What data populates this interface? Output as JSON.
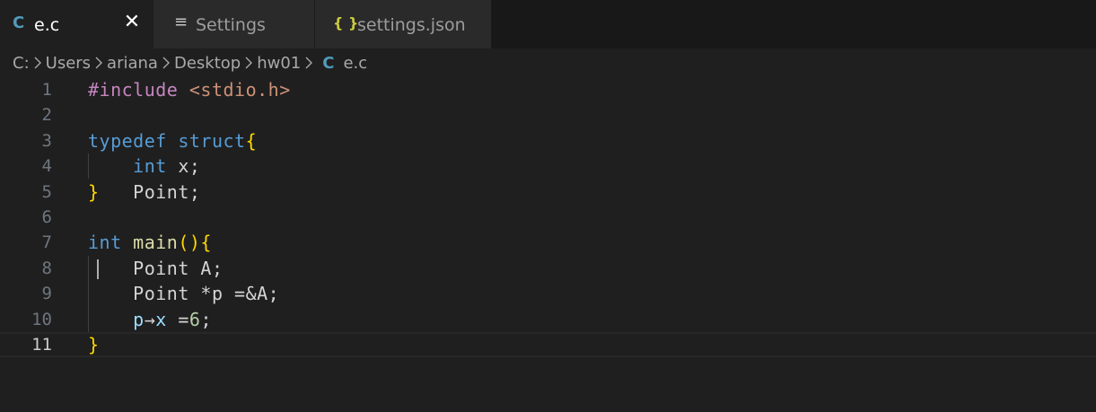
{
  "tabs": [
    {
      "icon": "C",
      "label": "e.c",
      "close": "✕"
    },
    {
      "icon": "≡",
      "label": "Settings"
    },
    {
      "icon": "{ }",
      "label": "settings.json"
    }
  ],
  "breadcrumb": {
    "parts": [
      "C:",
      "Users",
      "ariana",
      "Desktop",
      "hw01"
    ],
    "file_icon": "C",
    "file": "e.c"
  },
  "editor": {
    "current_line": 11,
    "lines": [
      {
        "n": "1",
        "tokens": [
          [
            "#include ",
            "pre"
          ],
          [
            "<stdio.h>",
            "str"
          ]
        ]
      },
      {
        "n": "2",
        "tokens": []
      },
      {
        "n": "3",
        "tokens": [
          [
            "typedef ",
            "kw"
          ],
          [
            "struct",
            "kw"
          ],
          [
            "{",
            "br"
          ]
        ]
      },
      {
        "n": "4",
        "tokens": [
          [
            "    ",
            "txt"
          ],
          [
            "int",
            "kw"
          ],
          [
            " x;",
            "txt"
          ]
        ]
      },
      {
        "n": "5",
        "tokens": [
          [
            "}",
            "br"
          ],
          [
            "   Point;",
            "txt"
          ]
        ]
      },
      {
        "n": "6",
        "tokens": []
      },
      {
        "n": "7",
        "tokens": [
          [
            "int",
            "kw"
          ],
          [
            " ",
            "txt"
          ],
          [
            "main",
            "fn"
          ],
          [
            "(){",
            "br"
          ]
        ]
      },
      {
        "n": "8",
        "tokens": [
          [
            "    Point A;",
            "txt"
          ]
        ]
      },
      {
        "n": "9",
        "tokens": [
          [
            "    Point *p =&A;",
            "txt"
          ]
        ]
      },
      {
        "n": "10",
        "tokens": [
          [
            "    ",
            "txt"
          ],
          [
            "p",
            "var"
          ],
          [
            "→",
            "txt"
          ],
          [
            "x",
            "var"
          ],
          [
            " =",
            "txt"
          ],
          [
            "6",
            "num"
          ],
          [
            ";",
            "txt"
          ]
        ]
      },
      {
        "n": "11",
        "tokens": [
          [
            "}",
            "br"
          ]
        ]
      }
    ]
  },
  "colors": {
    "c_icon": "#519aba",
    "json_icon": "#cbcb41",
    "active_tab_bg": "#1f1f1f",
    "inactive_tab_bg": "#2a2a2a"
  }
}
